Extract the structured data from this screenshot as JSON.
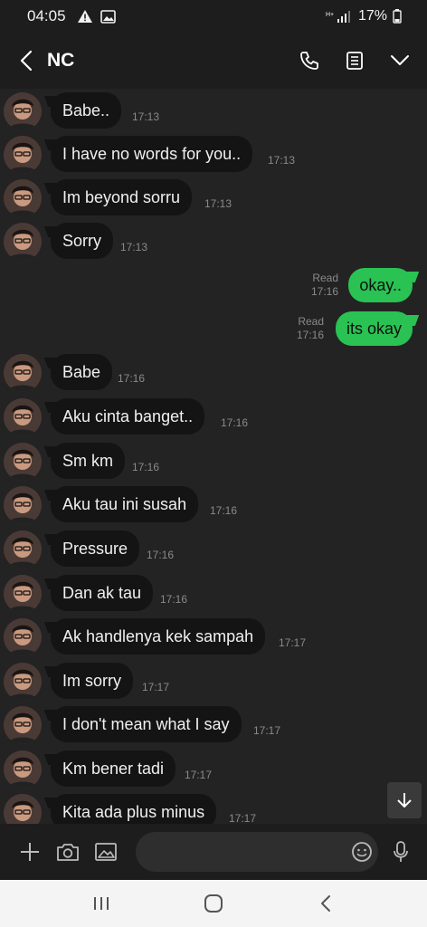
{
  "status_bar": {
    "time": "04:05",
    "battery": "17%",
    "network": "4G"
  },
  "header": {
    "title": "NC"
  },
  "messages_incoming_1": [
    {
      "text": "Babe..",
      "time": "17:13"
    },
    {
      "text": "I have no words for you..",
      "time": "17:13"
    },
    {
      "text": "Im beyond sorru",
      "time": "17:13"
    },
    {
      "text": "Sorry",
      "time": "17:13"
    }
  ],
  "messages_outgoing": [
    {
      "text": "okay..",
      "read": "Read",
      "time": "17:16"
    },
    {
      "text": "its okay",
      "read": "Read",
      "time": "17:16"
    }
  ],
  "messages_incoming_2": [
    {
      "text": "Babe",
      "time": "17:16"
    },
    {
      "text": "Aku cinta banget..",
      "time": "17:16"
    },
    {
      "text": "Sm km",
      "time": "17:16"
    },
    {
      "text": "Aku tau ini susah",
      "time": "17:16"
    },
    {
      "text": "Pressure",
      "time": "17:16"
    },
    {
      "text": "Dan ak tau",
      "time": "17:16"
    },
    {
      "text": "Ak handlenya kek sampah",
      "time": "17:17"
    },
    {
      "text": "Im sorry",
      "time": "17:17"
    },
    {
      "text": "I don't mean what I say",
      "time": "17:17"
    },
    {
      "text": "Km bener tadi",
      "time": "17:17"
    },
    {
      "text": "Kita ada plus minus",
      "time": "17:17"
    }
  ],
  "input": {
    "placeholder": "",
    "value": ""
  },
  "icons": {
    "status": [
      "alert-icon",
      "image-icon",
      "signal-icon",
      "battery-icon"
    ],
    "header": [
      "back-icon",
      "phone-icon",
      "notes-icon",
      "chevron-down-icon"
    ],
    "input": [
      "plus-icon",
      "camera-icon",
      "gallery-icon",
      "emoji-icon",
      "mic-icon"
    ],
    "nav": [
      "recents-icon",
      "home-icon",
      "back-nav-icon"
    ]
  },
  "colors": {
    "background": "#232323",
    "bar": "#1d1d1d",
    "incoming_bubble": "#141414",
    "outgoing_bubble": "#29c253",
    "timestamp": "#8a8a8a"
  }
}
